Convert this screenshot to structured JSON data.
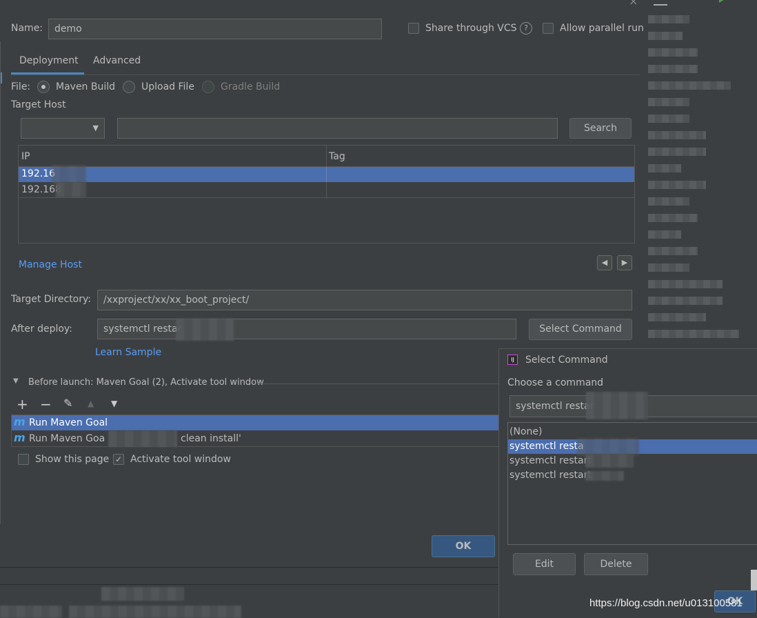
{
  "dialog": {
    "name_label": "Name:",
    "name_value": "demo",
    "share_vcs_label": "Share through VCS",
    "help_glyph": "?",
    "allow_parallel_label": "Allow parallel run",
    "tabs": [
      {
        "label": "Deployment"
      },
      {
        "label": "Advanced"
      }
    ],
    "file_label": "File:",
    "file_options": [
      {
        "label": "Maven Build"
      },
      {
        "label": "Upload File"
      },
      {
        "label": "Gradle Build"
      }
    ],
    "target_host_label": "Target Host",
    "search_button": "Search",
    "table": {
      "columns": [
        "IP",
        "Tag"
      ],
      "rows": [
        {
          "ip": "192.16",
          "tag": ""
        },
        {
          "ip": "192.168",
          "tag": ""
        }
      ]
    },
    "manage_host_link": "Manage Host",
    "target_dir_label": "Target Directory:",
    "target_dir_value": "/xxproject/xx/xx_boot_project/",
    "after_deploy_label": "After deploy:",
    "after_deploy_value": "systemctl restar",
    "select_command_button": "Select Command",
    "learn_sample_link": "Learn Sample",
    "before_launch_label": "Before launch: Maven Goal (2), Activate tool window",
    "maven_icon_glyph": "m",
    "launch_tasks": [
      {
        "label": "Run Maven Goal"
      },
      {
        "label": "Run Maven Goa",
        "suffix": "clean install'"
      }
    ],
    "show_page_label": "Show this page",
    "activate_tool_label": "Activate tool window",
    "ok_button": "OK"
  },
  "popup": {
    "title": "Select Command",
    "prompt": "Choose a command",
    "input_value": "systemctl restar",
    "commands": [
      {
        "label": "(None)"
      },
      {
        "label": "systemctl resta"
      },
      {
        "label": "systemctl restart"
      },
      {
        "label": "systemctl restart"
      }
    ],
    "edit_button": "Edit",
    "delete_button": "Delete",
    "ok_button": "OK"
  },
  "watermark": "https://blog.csdn.net/u013100581",
  "colors": {
    "selection": "#4b6eaf",
    "link": "#589df6",
    "primary_button": "#365880",
    "background": "#3c3f41"
  }
}
